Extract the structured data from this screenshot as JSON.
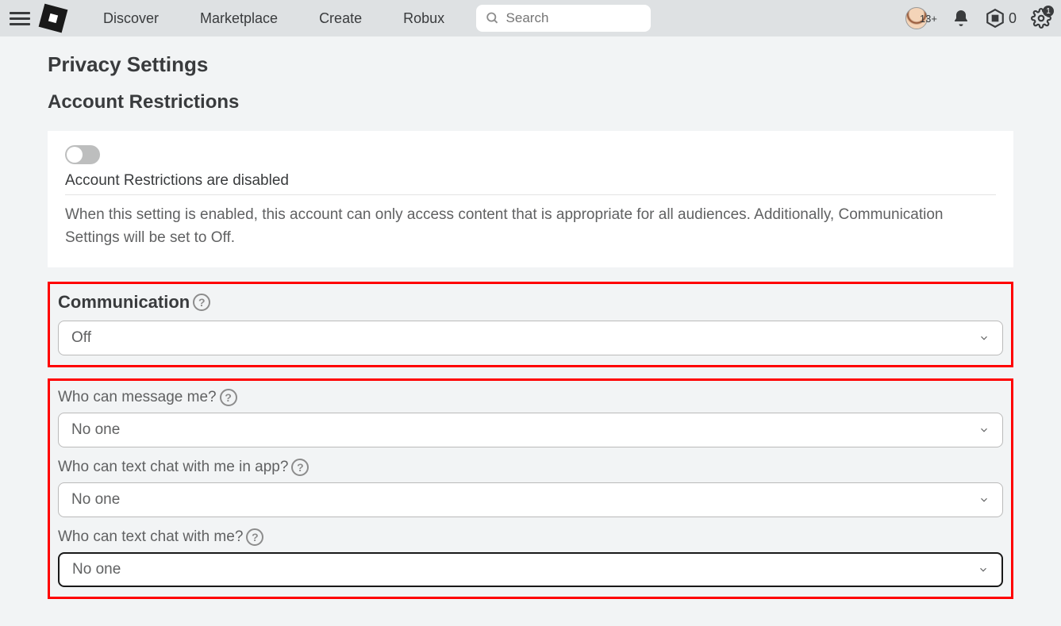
{
  "nav": {
    "links": [
      "Discover",
      "Marketplace",
      "Create",
      "Robux"
    ],
    "search_placeholder": "Search",
    "age_badge": "13+",
    "robux_count": "0",
    "gear_badge": "1"
  },
  "page": {
    "title": "Privacy Settings",
    "subtitle": "Account Restrictions"
  },
  "restrictions": {
    "status_text": "Account Restrictions are disabled",
    "description": "When this setting is enabled, this account can only access content that is appropriate for all audiences. Additionally, Communication Settings will be set to Off."
  },
  "communication": {
    "label": "Communication",
    "value": "Off"
  },
  "fields": [
    {
      "label": "Who can message me?",
      "value": "No one"
    },
    {
      "label": "Who can text chat with me in app?",
      "value": "No one"
    },
    {
      "label": "Who can text chat with me?",
      "value": "No one"
    }
  ]
}
